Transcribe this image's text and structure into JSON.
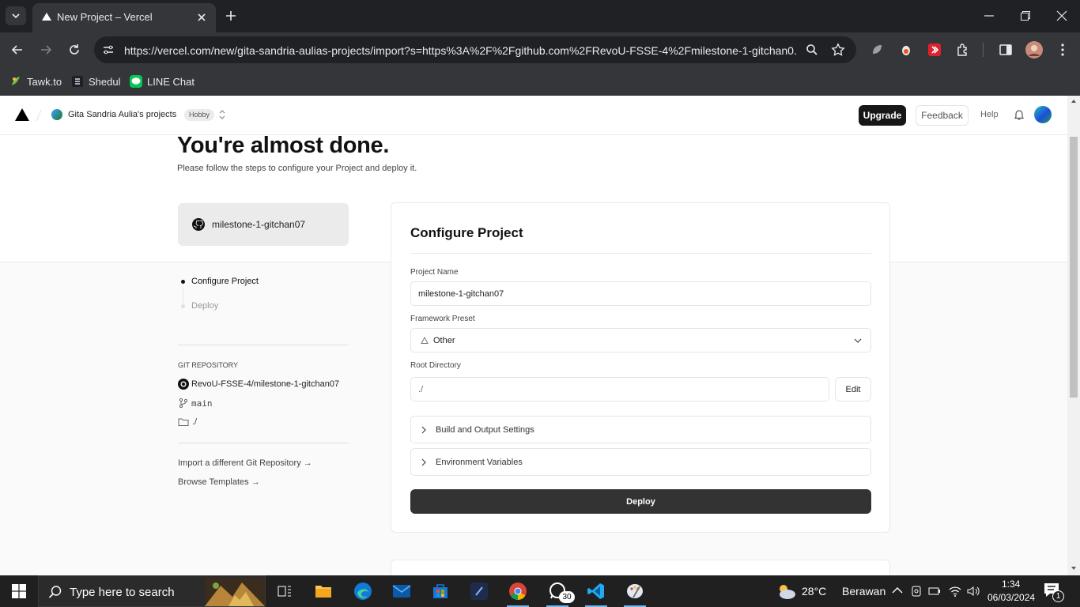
{
  "browser": {
    "tab_title": "New Project – Vercel",
    "url": "https://vercel.com/new/gita-sandria-aulias-projects/import?s=https%3A%2F%2Fgithub.com%2FRevoU-FSSE-4%2Fmilestone-1-gitchan0...",
    "bookmarks": [
      {
        "label": "Tawk.to"
      },
      {
        "label": "Shedul"
      },
      {
        "label": "LINE Chat"
      }
    ]
  },
  "header": {
    "scope_name": "Gita Sandria Aulia's projects",
    "plan_badge": "Hobby",
    "upgrade_label": "Upgrade",
    "feedback_label": "Feedback",
    "help_label": "Help"
  },
  "hero": {
    "title": "You're almost done.",
    "subtitle": "Please follow the steps to configure your Project and deploy it."
  },
  "repo_card": {
    "name": "milestone-1-gitchan07"
  },
  "steps": [
    {
      "label": "Configure Project",
      "active": true
    },
    {
      "label": "Deploy",
      "active": false
    }
  ],
  "git_repository": {
    "heading": "GIT REPOSITORY",
    "repo": "RevoU-FSSE-4/milestone-1-gitchan07",
    "branch": "main",
    "directory": "./"
  },
  "links": {
    "import_different": "Import a different Git Repository →",
    "browse_templates": "Browse Templates →"
  },
  "configure": {
    "title": "Configure Project",
    "project_name_label": "Project Name",
    "project_name_value": "milestone-1-gitchan07",
    "framework_label": "Framework Preset",
    "framework_value": "Other",
    "root_dir_label": "Root Directory",
    "root_dir_value": "./",
    "edit_label": "Edit",
    "build_settings_label": "Build and Output Settings",
    "env_vars_label": "Environment Variables",
    "deploy_label": "Deploy"
  },
  "taskbar": {
    "search_placeholder": "Type here to search",
    "whatsapp_badge": "30",
    "weather_temp": "28°C",
    "weather_desc": "Berawan",
    "time": "1:34",
    "date": "06/03/2024",
    "notification_count": "1"
  },
  "colors": {
    "chrome_dark": "#202124",
    "chrome_toolbar": "#35363a",
    "primary_button": "#171717",
    "deploy_button": "#333333",
    "taskbar": "#202020"
  }
}
